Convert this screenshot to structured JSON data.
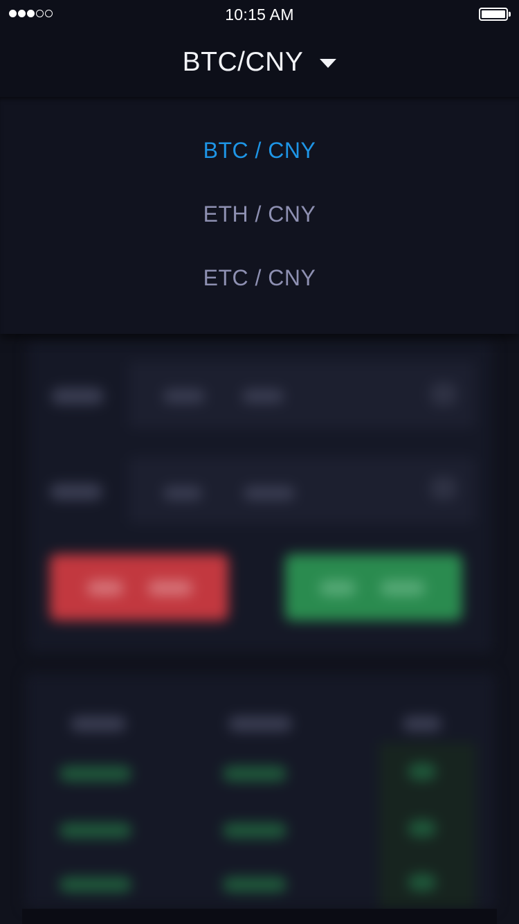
{
  "status_bar": {
    "signal_bars": 5,
    "signal_filled": 3,
    "time": "10:15 AM",
    "battery_icon": "battery-full-icon"
  },
  "header": {
    "title": "BTC/CNY",
    "dropdown_icon": "caret-down-icon"
  },
  "dropdown": {
    "options": [
      {
        "label": "BTC / CNY",
        "selected": true
      },
      {
        "label": "ETH / CNY",
        "selected": false
      },
      {
        "label": "ETC / CNY",
        "selected": false
      }
    ]
  },
  "colors": {
    "background": "#10121d",
    "header_bg": "#0d0f19",
    "selected_option": "#1e95e6",
    "option_text": "#8e90b2",
    "sell_button": "#c2383f",
    "buy_button": "#2a8b4f"
  }
}
